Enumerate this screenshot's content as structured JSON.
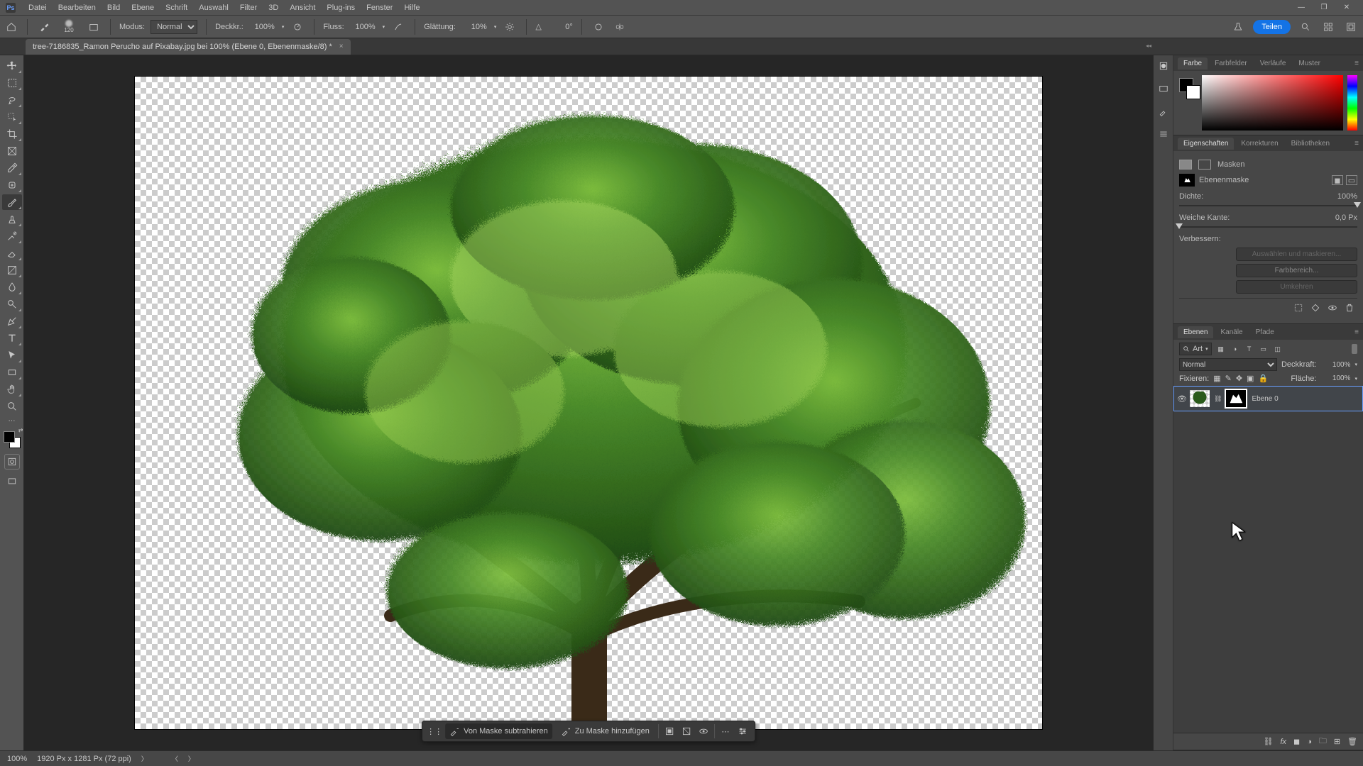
{
  "menu": {
    "items": [
      "Datei",
      "Bearbeiten",
      "Bild",
      "Ebene",
      "Schrift",
      "Auswahl",
      "Filter",
      "3D",
      "Ansicht",
      "Plug-ins",
      "Fenster",
      "Hilfe"
    ]
  },
  "options": {
    "brush_size": "120",
    "modus_label": "Modus:",
    "modus_value": "Normal",
    "deckkr_label": "Deckkr.:",
    "deckkr_value": "100%",
    "fluss_label": "Fluss:",
    "fluss_value": "100%",
    "glaettung_label": "Glättung:",
    "glaettung_value": "10%",
    "angle_symbol": "△",
    "angle_value": "0°",
    "share": "Teilen"
  },
  "tab": {
    "title": "tree-7186835_Ramon Perucho auf Pixabay.jpg bei 100% (Ebene 0, Ebenenmaske/8) *"
  },
  "mask_toolbar": {
    "subtract": "Von Maske subtrahieren",
    "add": "Zu Maske hinzufügen"
  },
  "panels": {
    "farbe": {
      "tabs": [
        "Farbe",
        "Farbfelder",
        "Verläufe",
        "Muster"
      ]
    },
    "eigenschaften": {
      "tabs": [
        "Eigenschaften",
        "Korrekturen",
        "Bibliotheken"
      ],
      "mask_section": "Masken",
      "mask_type": "Ebenenmaske",
      "dichte_label": "Dichte:",
      "dichte_value": "100%",
      "kante_label": "Weiche Kante:",
      "kante_value": "0,0 Px",
      "verbessern_label": "Verbessern:",
      "btn_auswaehlen": "Auswählen und maskieren...",
      "btn_farbbereich": "Farbbereich...",
      "btn_umkehren": "Umkehren"
    },
    "ebenen": {
      "tabs": [
        "Ebenen",
        "Kanäle",
        "Pfade"
      ],
      "filter_kind": "Art",
      "blend_mode": "Normal",
      "deckkraft_label": "Deckkraft:",
      "deckkraft_value": "100%",
      "fixieren_label": "Fixieren:",
      "flaeche_label": "Fläche:",
      "flaeche_value": "100%",
      "layer0": "Ebene 0"
    }
  },
  "status": {
    "zoom": "100%",
    "doc": "1920 Px x 1281 Px (72 ppi)"
  }
}
